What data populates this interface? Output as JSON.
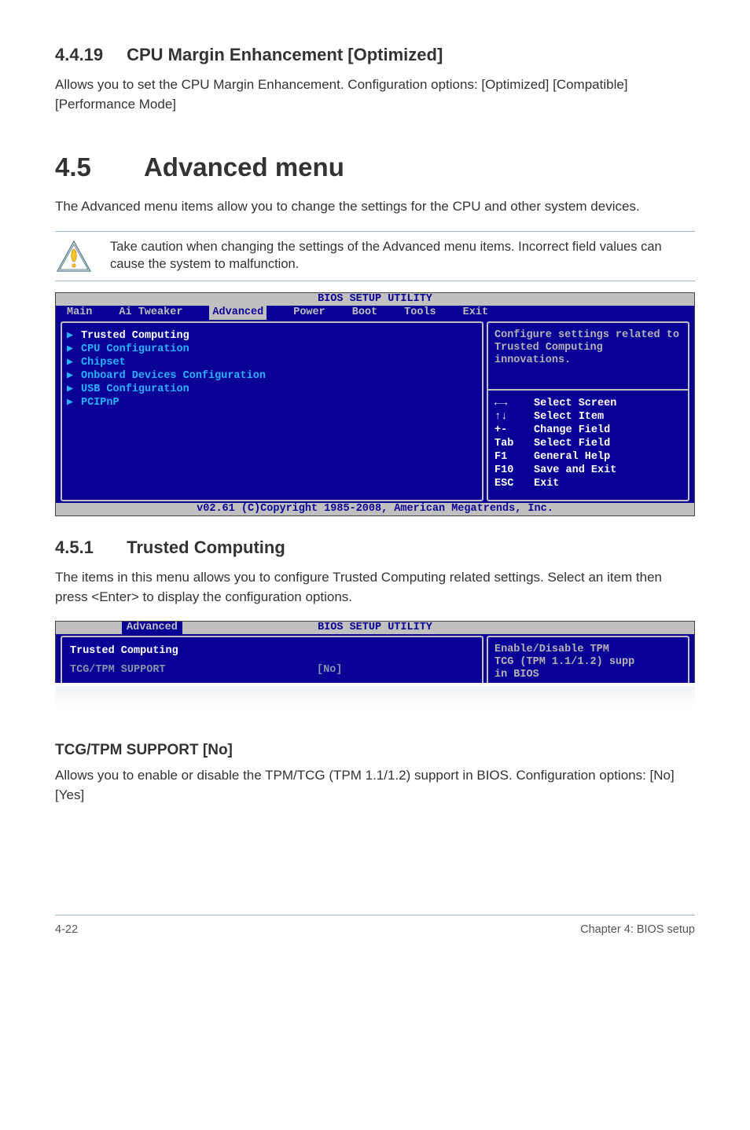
{
  "sec419": {
    "number": "4.4.19",
    "title": "CPU Margin Enhancement [Optimized]",
    "text": "Allows you to set the CPU Margin Enhancement. Configuration options: [Optimized] [Compatible] [Performance Mode]"
  },
  "sec45": {
    "number": "4.5",
    "title": "Advanced menu",
    "text": "The Advanced menu items allow you to change the settings for the CPU and other system devices.",
    "note": "Take caution when changing the settings of the Advanced menu items. Incorrect field values can cause the system to malfunction."
  },
  "bios1": {
    "title": "BIOS SETUP UTILITY",
    "tabs": [
      "Main",
      "Ai Tweaker",
      "Advanced",
      "Power",
      "Boot",
      "Tools",
      "Exit"
    ],
    "selected_tab": "Advanced",
    "menu": [
      {
        "label": "Trusted Computing",
        "sel": true
      },
      {
        "label": "CPU Configuration",
        "sel": false
      },
      {
        "label": "Chipset",
        "sel": false
      },
      {
        "label": "Onboard Devices Configuration",
        "sel": false
      },
      {
        "label": "USB Configuration",
        "sel": false
      },
      {
        "label": "PCIPnP",
        "sel": false
      }
    ],
    "help": "Configure settings related to Trusted Computing innovations.",
    "keys": [
      {
        "k": "←→",
        "v": "Select Screen"
      },
      {
        "k": "↑↓",
        "v": "Select Item"
      },
      {
        "k": "+-",
        "v": "Change Field"
      },
      {
        "k": "Tab",
        "v": "Select Field"
      },
      {
        "k": "F1",
        "v": "General Help"
      },
      {
        "k": "F10",
        "v": "Save and Exit"
      },
      {
        "k": "ESC",
        "v": "Exit"
      }
    ],
    "copyright": "v02.61 (C)Copyright 1985-2008, American Megatrends, Inc."
  },
  "sec451": {
    "number": "4.5.1",
    "title": "Trusted Computing",
    "text": "The items in this menu allows you to configure Trusted Computing related settings. Select an item then press <Enter> to display the configuration options."
  },
  "bios2": {
    "title": "BIOS SETUP UTILITY",
    "tab": "Advanced",
    "header": "Trusted Computing",
    "row_label": "TCG/TPM SUPPORT",
    "row_value": "[No]",
    "help_line1": "Enable/Disable TPM",
    "help_line2": "TCG (TPM 1.1/1.2) supp",
    "help_line3": "in BIOS"
  },
  "sub": {
    "title": "TCG/TPM SUPPORT [No]",
    "text": "Allows you to enable or disable the TPM/TCG (TPM 1.1/1.2) support in BIOS. Configuration options: [No] [Yes]"
  },
  "footer": {
    "left": "4-22",
    "right": "Chapter 4: BIOS setup"
  }
}
